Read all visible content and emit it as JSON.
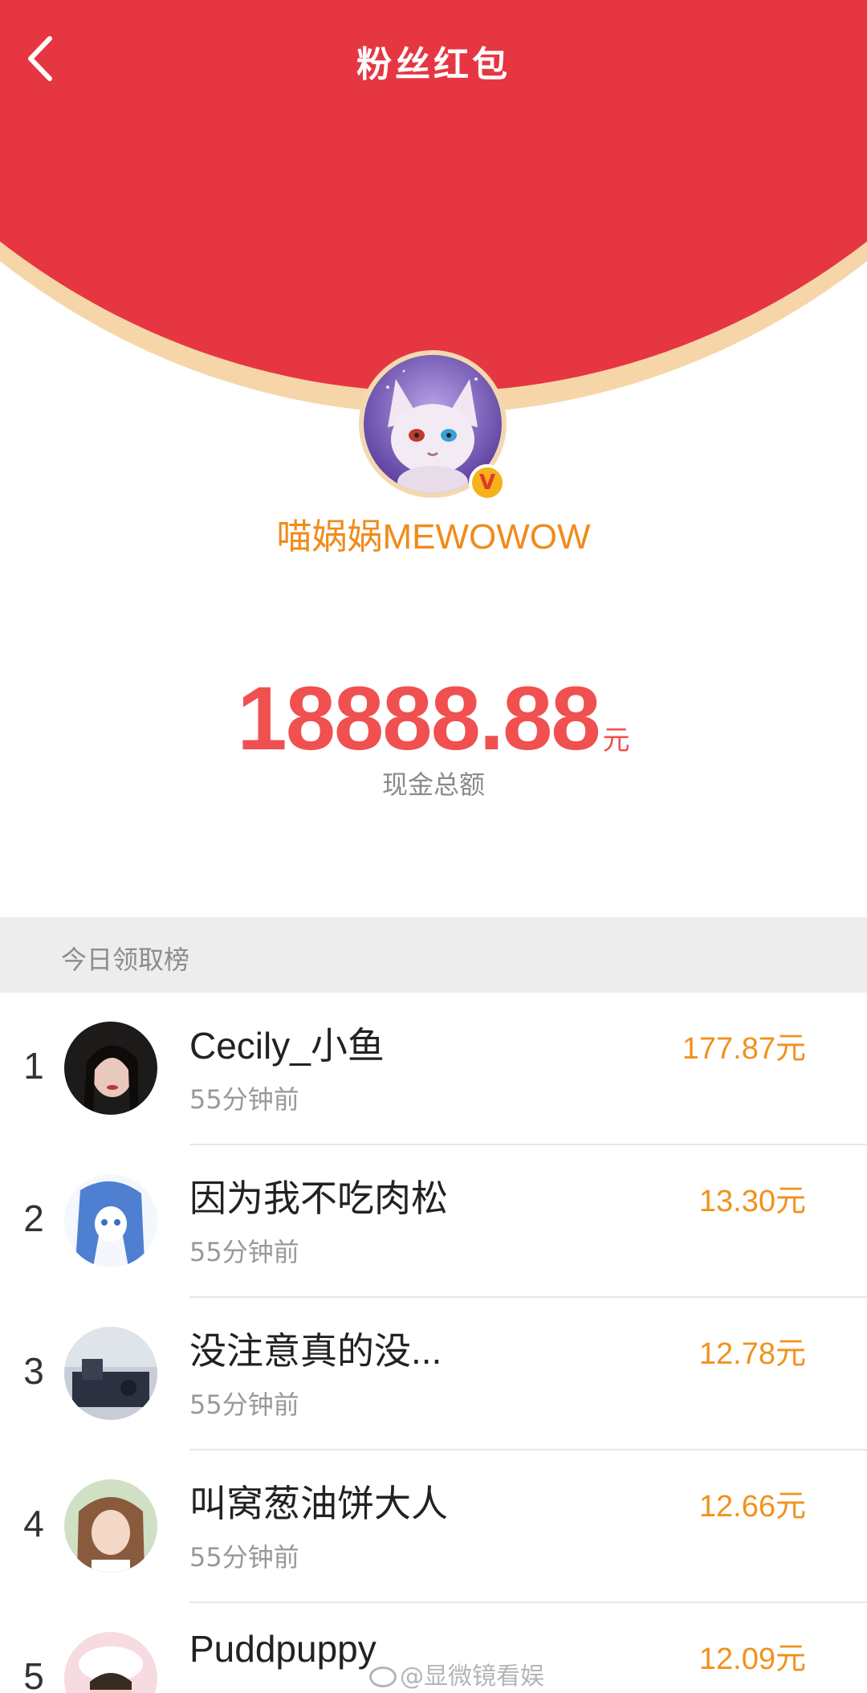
{
  "header": {
    "title": "粉丝红包",
    "back_icon": "chevron-left-icon"
  },
  "creator": {
    "name": "喵娲娲MEWOWOW",
    "verified_badge": "V"
  },
  "total": {
    "amount": "18888.88",
    "unit": "元",
    "label": "现金总额"
  },
  "section": {
    "title": "今日领取榜"
  },
  "leaderboard": [
    {
      "rank": "1",
      "name": "Cecily_小鱼",
      "time": "55分钟前",
      "amount": "177.87元"
    },
    {
      "rank": "2",
      "name": "因为我不吃肉松",
      "time": "55分钟前",
      "amount": "13.30元"
    },
    {
      "rank": "3",
      "name": "没注意真的没...",
      "time": "55分钟前",
      "amount": "12.78元"
    },
    {
      "rank": "4",
      "name": "叫窝葱油饼大人",
      "time": "55分钟前",
      "amount": "12.66元"
    },
    {
      "rank": "5",
      "name": "Puddpuppy",
      "time": "",
      "amount": "12.09元"
    }
  ],
  "watermark": {
    "text": "@显微镜看娱"
  },
  "colors": {
    "envelope_red": "#e63642",
    "rim": "#f6d6a8",
    "amount": "#f05050",
    "accent_orange": "#f0921e"
  }
}
